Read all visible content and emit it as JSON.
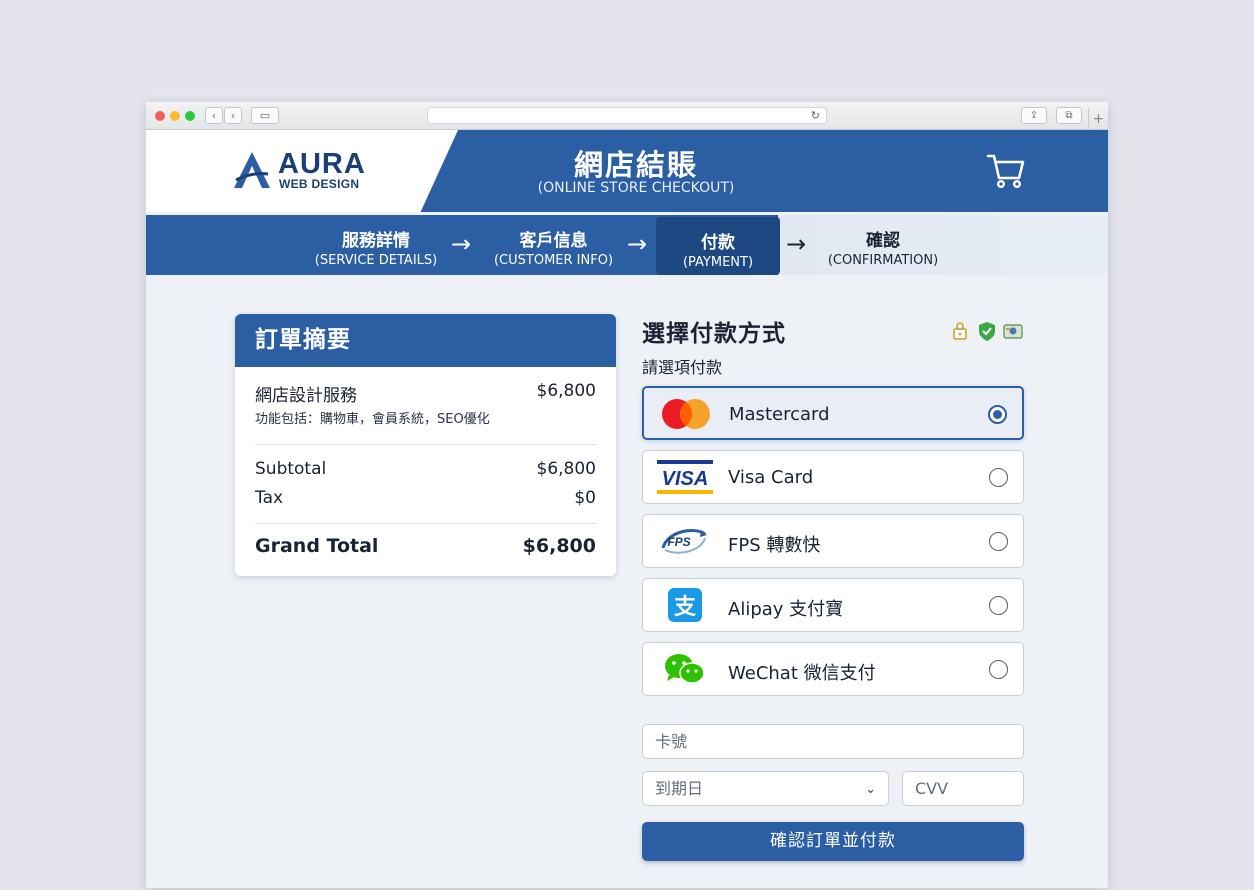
{
  "brand": {
    "name": "AURA",
    "tagline": "WEB DESIGN",
    "accent": "#2c5ea3",
    "dark": "#1e4882"
  },
  "header": {
    "title": "網店結賬",
    "subtitle": "(ONLINE STORE CHECKOUT)",
    "cart_icon": "cart-icon"
  },
  "steps": [
    {
      "zh": "服務詳情",
      "en": "(SERVICE DETAILS)"
    },
    {
      "zh": "客戶信息",
      "en": "(CUSTOMER INFO)"
    },
    {
      "zh": "付款",
      "en": "(PAYMENT)",
      "active": true
    },
    {
      "zh": "確認",
      "en": "(CONFIRMATION)"
    }
  ],
  "summary": {
    "title": "訂單摘要",
    "item_name": "網店設計服務",
    "item_price": "$6,800",
    "item_desc": "功能包括：購物車，會員系統，SEO優化",
    "subtotal_label": "Subtotal",
    "subtotal": "$6,800",
    "tax_label": "Tax",
    "tax": "$0",
    "total_label": "Grand Total",
    "total": "$6,800"
  },
  "payment": {
    "title": "選擇付款方式",
    "subtitle": "請選項付款",
    "security_icons": [
      "lock-icon",
      "shield-check-icon",
      "secure-card-icon"
    ],
    "methods": [
      {
        "label": "Mastercard",
        "icon": "mastercard-icon",
        "selected": true
      },
      {
        "label": "Visa Card",
        "icon": "visa-icon",
        "selected": false
      },
      {
        "label": "FPS 轉數快",
        "icon": "fps-icon",
        "selected": false
      },
      {
        "label": "Alipay 支付寶",
        "icon": "alipay-icon",
        "selected": false
      },
      {
        "label": "WeChat 微信支付",
        "icon": "wechat-icon",
        "selected": false
      }
    ],
    "card_placeholder": "卡號",
    "expiry_placeholder": "到期日",
    "cvv_placeholder": "CVV",
    "submit_label": "確認訂單並付款"
  }
}
